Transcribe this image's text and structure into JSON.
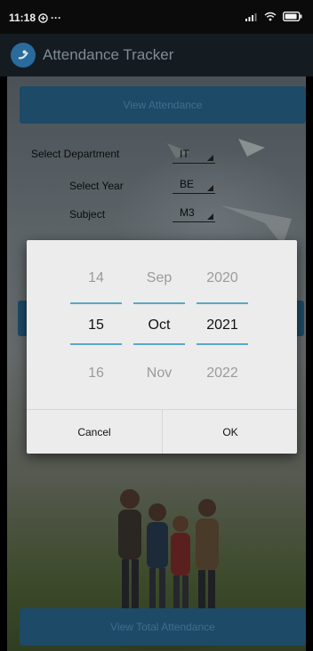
{
  "status_bar": {
    "time": "11:18",
    "dots": "···"
  },
  "app_bar": {
    "title": "Attendance Tracker"
  },
  "form": {
    "view_attendance_label": "View Attendance",
    "department_label": "Select Department",
    "department_value": "IT",
    "year_label": "Select Year",
    "year_value": "BE",
    "subject_label": "Subject",
    "subject_value": "M3",
    "view_total_label": "View Total Attendance"
  },
  "date_picker": {
    "day": {
      "prev": "14",
      "current": "15",
      "next": "16"
    },
    "month": {
      "prev": "Sep",
      "current": "Oct",
      "next": "Nov"
    },
    "year": {
      "prev": "2020",
      "current": "2021",
      "next": "2022"
    },
    "cancel_label": "Cancel",
    "ok_label": "OK"
  },
  "colors": {
    "accent": "#5aa8c8",
    "button": "#1d4a66",
    "app_bar": "#141c22"
  }
}
